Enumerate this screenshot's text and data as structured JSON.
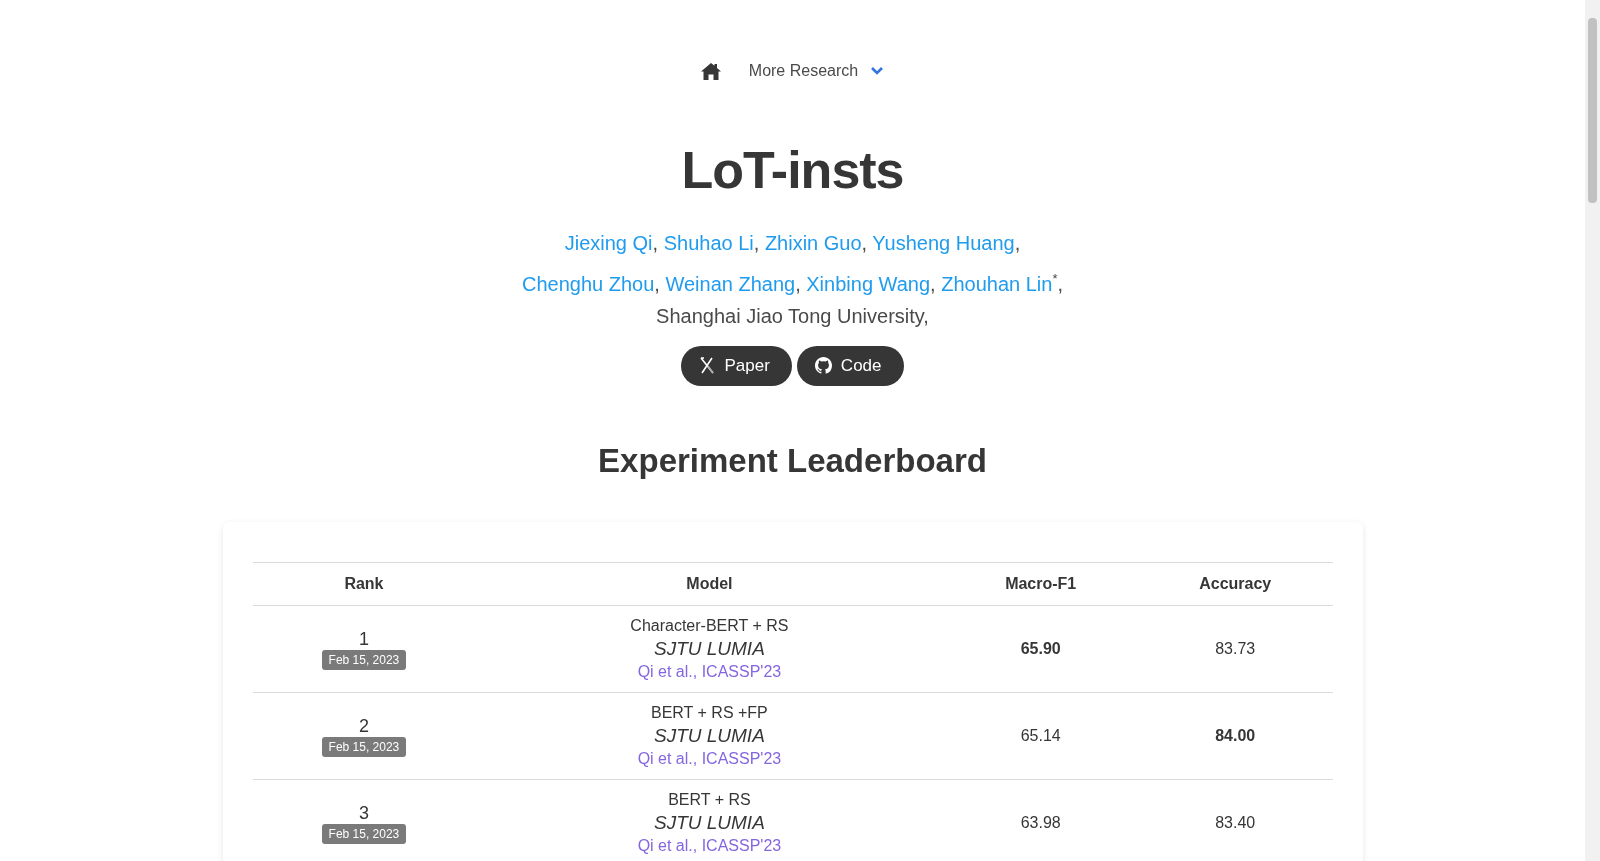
{
  "nav": {
    "menu_label": "More Research"
  },
  "title": "LoT-insts",
  "authors": [
    [
      {
        "name": "Jiexing Qi",
        "suffix": ","
      },
      {
        "name": "Shuhao Li",
        "suffix": ","
      },
      {
        "name": "Zhixin Guo",
        "suffix": ","
      },
      {
        "name": "Yusheng Huang",
        "suffix": ","
      }
    ],
    [
      {
        "name": "Chenghu Zhou",
        "suffix": ","
      },
      {
        "name": "Weinan Zhang",
        "suffix": ","
      },
      {
        "name": "Xinbing Wang",
        "suffix": ","
      },
      {
        "name": "Zhouhan Lin",
        "mark": "*",
        "suffix": ","
      }
    ]
  ],
  "affiliation": "Shanghai Jiao Tong University,",
  "buttons": [
    {
      "kind": "arxiv",
      "label": "Paper"
    },
    {
      "kind": "github",
      "label": "Code"
    }
  ],
  "leaderboard": {
    "heading": "Experiment Leaderboard",
    "columns": [
      "Rank",
      "Model",
      "Macro-F1",
      "Accuracy"
    ],
    "rows": [
      {
        "rank": "1",
        "date": "Feb 15, 2023",
        "model": "Character-BERT + RS",
        "team": "SJTU LUMIA",
        "citation": "Qi et al., ICASSP'23",
        "macro_f1": {
          "value": "65.90",
          "best": true
        },
        "accuracy": {
          "value": "83.73",
          "best": false
        }
      },
      {
        "rank": "2",
        "date": "Feb 15, 2023",
        "model": "BERT + RS +FP",
        "team": "SJTU LUMIA",
        "citation": "Qi et al., ICASSP'23",
        "macro_f1": {
          "value": "65.14",
          "best": false
        },
        "accuracy": {
          "value": "84.00",
          "best": true
        }
      },
      {
        "rank": "3",
        "date": "Feb 15, 2023",
        "model": "BERT + RS",
        "team": "SJTU LUMIA",
        "citation": "Qi et al., ICASSP'23",
        "macro_f1": {
          "value": "63.98",
          "best": false
        },
        "accuracy": {
          "value": "83.40",
          "best": false
        }
      }
    ]
  }
}
